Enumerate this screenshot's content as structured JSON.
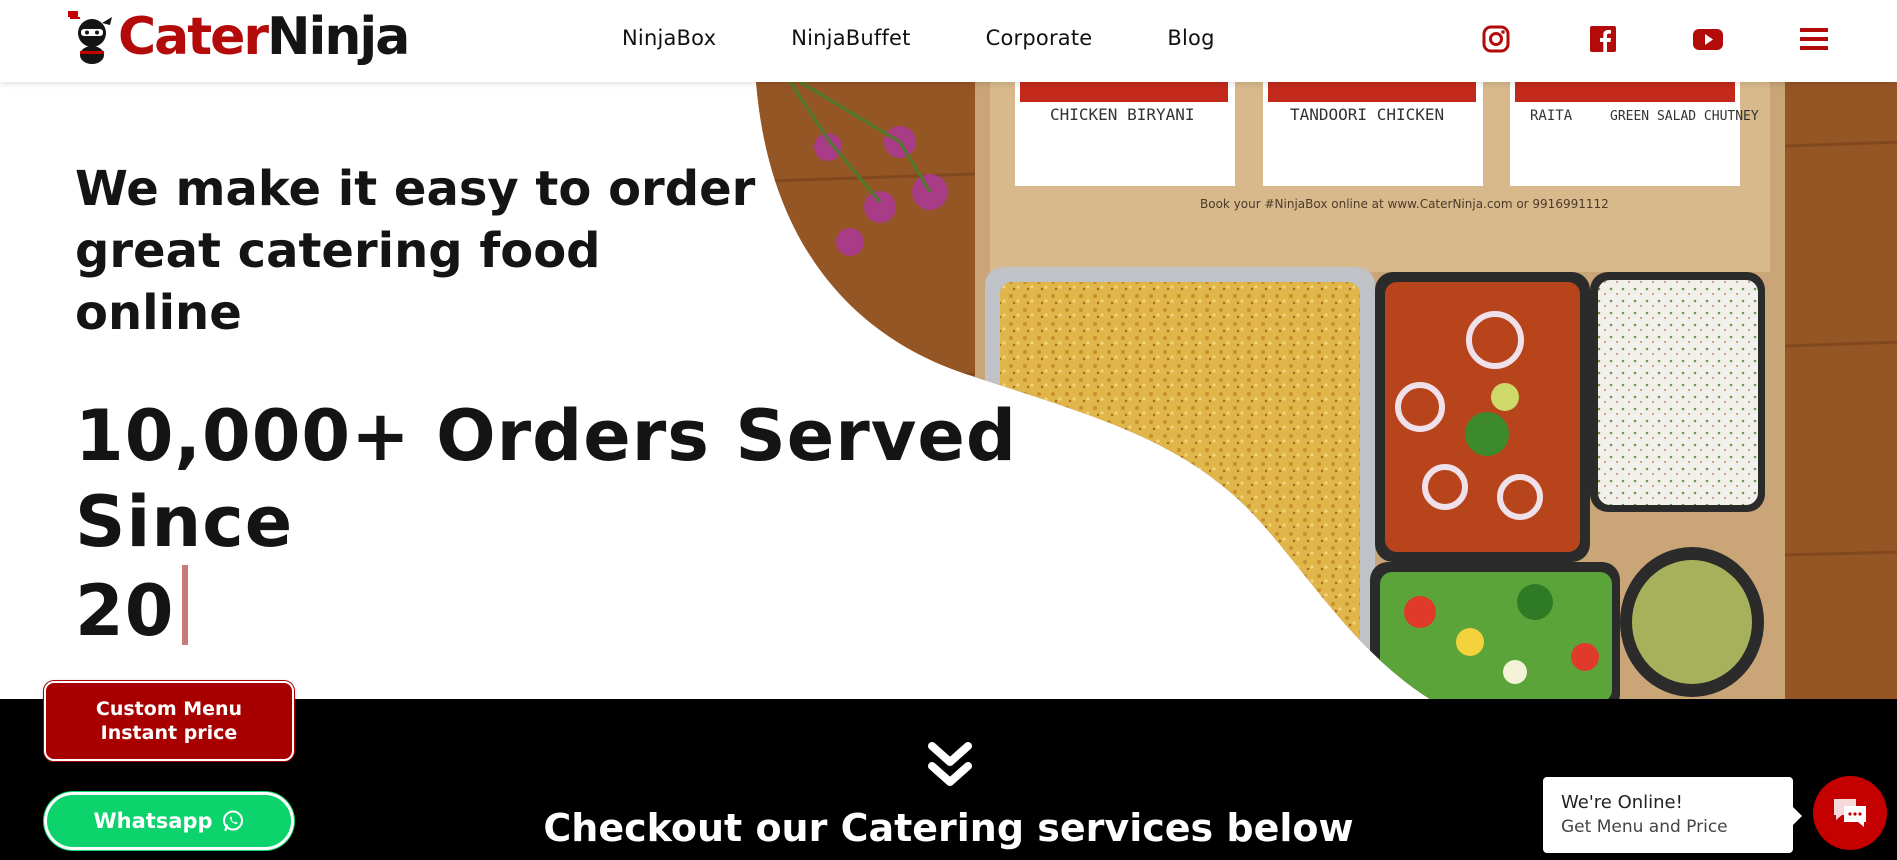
{
  "brand": {
    "name_part1": "Cater",
    "name_part2": "Ninja",
    "accent_color": "#b30a0a"
  },
  "nav": {
    "items": [
      {
        "label": "NinjaBox"
      },
      {
        "label": "NinjaBuffet"
      },
      {
        "label": "Corporate"
      },
      {
        "label": "Blog"
      }
    ]
  },
  "social": {
    "icons": [
      "instagram-icon",
      "facebook-icon",
      "youtube-icon",
      "hamburger-menu-icon"
    ]
  },
  "hero": {
    "headline": "We make it easy to order great catering food online",
    "counter_line1": "10,000+ Orders Served Since",
    "counter_line2": "20",
    "photo_labels": {
      "box1": "CHICKEN BIRYANI",
      "box2": "TANDOORI CHICKEN",
      "box3a": "RAITA",
      "box3b": "GREEN SALAD CHUTNEY",
      "box_footer": "Book your #NinjaBox online at www.CaterNinja.com or 9916991112"
    }
  },
  "band": {
    "title": "Checkout our Catering services below",
    "arrow_icon": "double-chevron-down-icon"
  },
  "buttons": {
    "custom_menu_line1": "Custom Menu",
    "custom_menu_line2": "Instant price",
    "whatsapp_label": "Whatsapp",
    "whatsapp_color": "#0cd36b",
    "custom_color": "#a80000"
  },
  "chat": {
    "title": "We're Online!",
    "subtitle": "Get Menu and Price",
    "button_color": "#c40000"
  }
}
